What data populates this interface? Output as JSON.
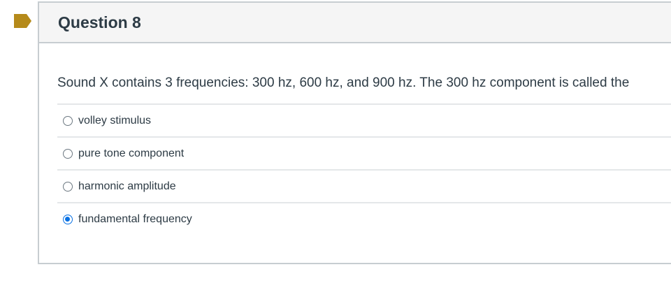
{
  "question": {
    "title": "Question 8",
    "text": "Sound X contains 3 frequencies: 300 hz, 600 hz, and 900 hz. The 300 hz component is called the",
    "flag_icon": "bookmark-flag-icon",
    "accent_color": "#0770e3",
    "flag_color": "#b58a1a"
  },
  "answers": [
    {
      "label": "volley stimulus",
      "selected": false
    },
    {
      "label": "pure tone component",
      "selected": false
    },
    {
      "label": "harmonic amplitude",
      "selected": false
    },
    {
      "label": "fundamental frequency",
      "selected": true
    }
  ]
}
